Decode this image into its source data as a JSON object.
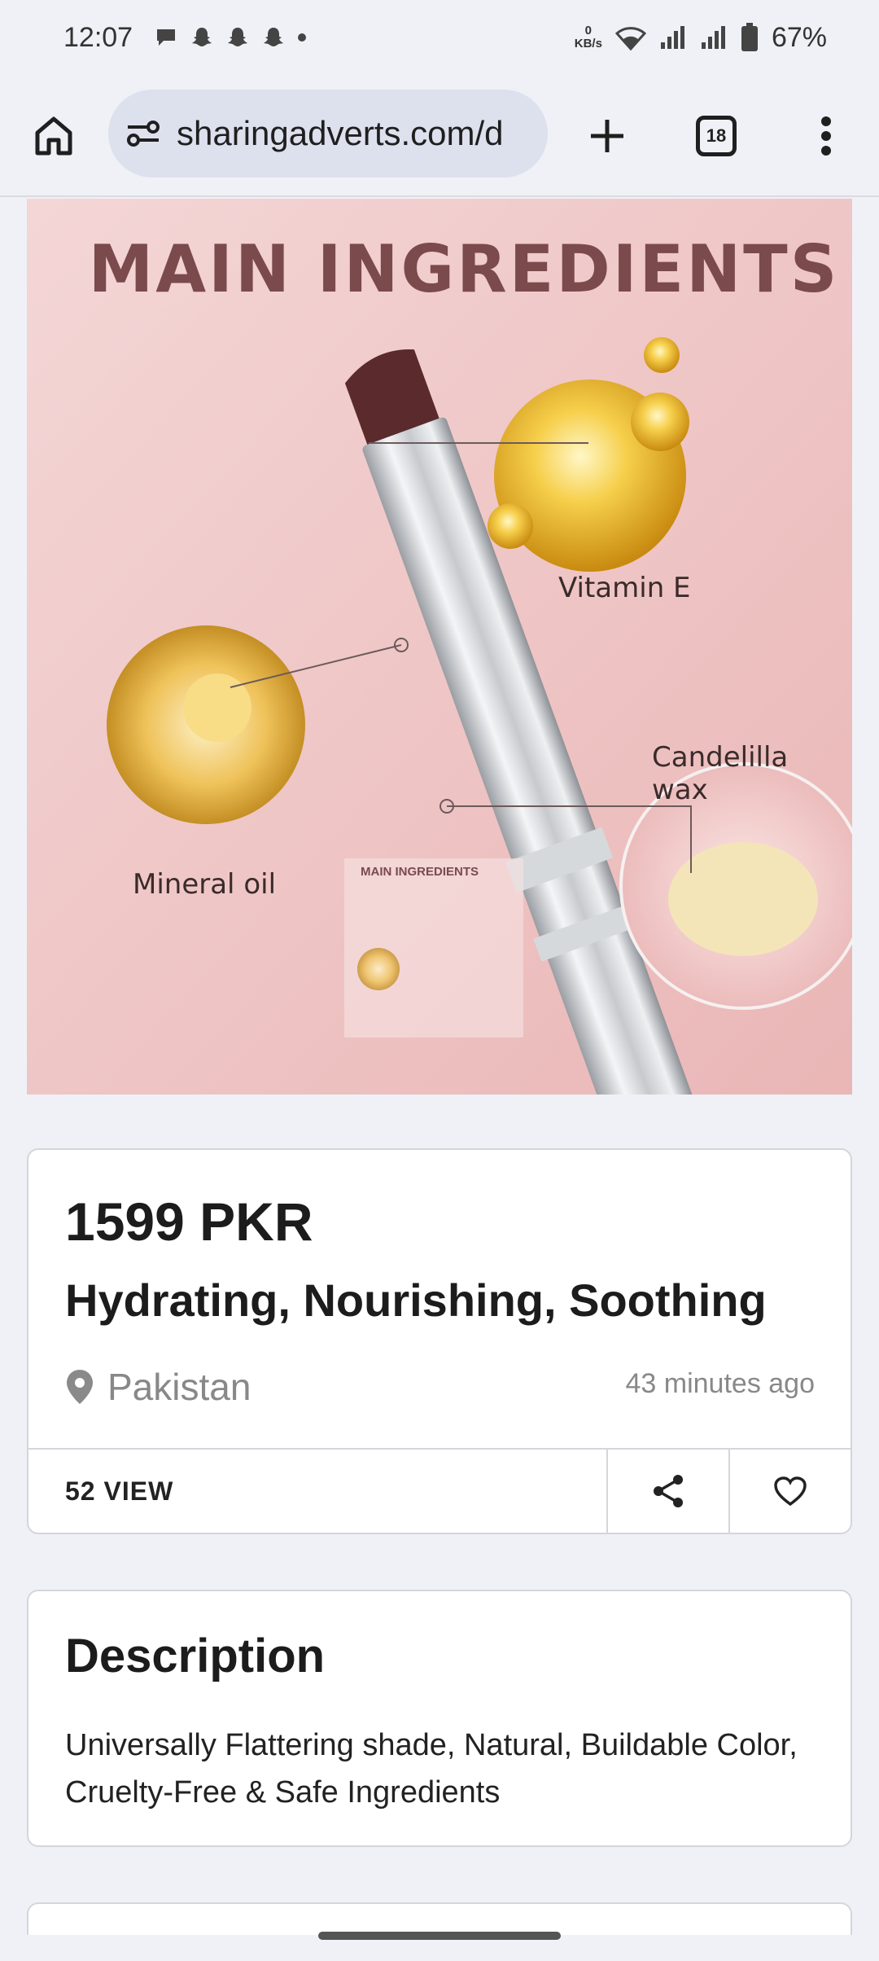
{
  "status_bar": {
    "time": "12:07",
    "net_speed_value": "0",
    "net_speed_unit": "KB/s",
    "battery": "67%"
  },
  "browser": {
    "url": "sharingadverts.com/d",
    "tab_count": "18"
  },
  "product_image": {
    "heading": "MAIN INGREDIENTS",
    "ingredients": [
      "Vitamin E",
      "Candelilla wax",
      "Mineral oil"
    ],
    "thumb_heading": "MAIN INGREDIENTS"
  },
  "listing": {
    "price": "1599 PKR",
    "title": "Hydrating, Nourishing, Soothing",
    "location": "Pakistan",
    "posted": "43 minutes ago",
    "views": "52 VIEW"
  },
  "description": {
    "heading": "Description",
    "body": "Universally Flattering shade, Natural, Buildable Color, Cruelty-Free & Safe Ingredients"
  }
}
